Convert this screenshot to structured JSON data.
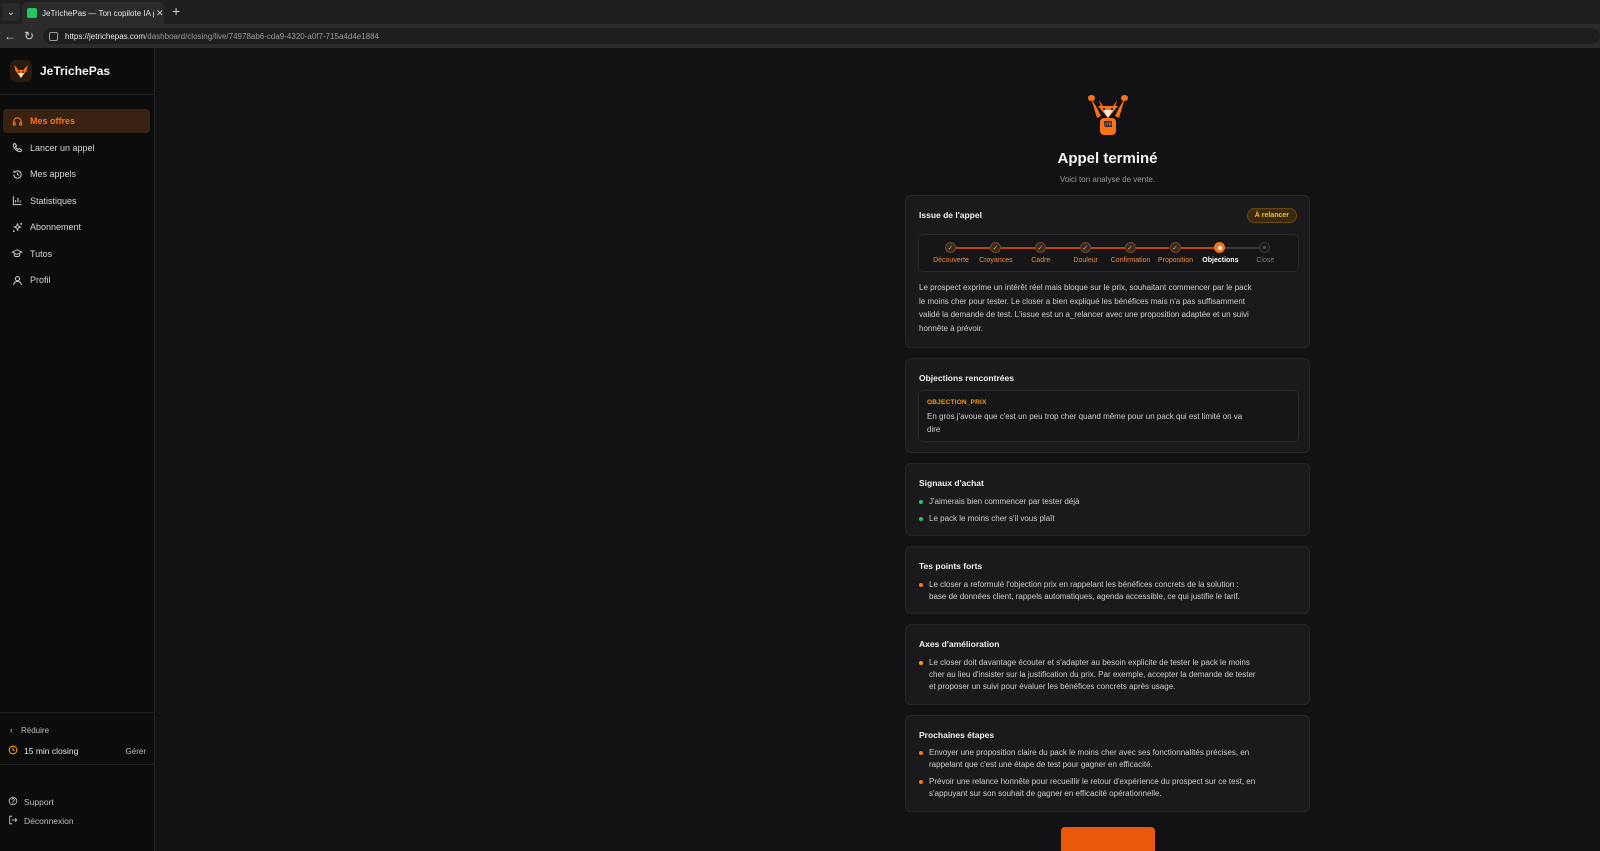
{
  "browser": {
    "tab_title": "JeTrichePas — Ton copilote IA pour",
    "url_host": "https://jetrichepas.com",
    "url_path": "/dashboard/closing/live/74978ab6-cda9-4320-a0f7-715a4d4e1884"
  },
  "sidebar": {
    "brand": "JeTrichePas",
    "items": [
      {
        "label": "Mes offres",
        "icon": "headphones-icon"
      },
      {
        "label": "Lancer un appel",
        "icon": "phone-icon"
      },
      {
        "label": "Mes appels",
        "icon": "history-icon"
      },
      {
        "label": "Statistiques",
        "icon": "bar-chart-icon"
      },
      {
        "label": "Abonnement",
        "icon": "sparkles-icon"
      },
      {
        "label": "Tutos",
        "icon": "graduation-cap-icon"
      },
      {
        "label": "Profil",
        "icon": "user-icon"
      }
    ],
    "reduce_label": "Réduire",
    "plan_label": "15 min closing",
    "manage_label": "Gérer",
    "support_label": "Support",
    "logout_label": "Déconnexion"
  },
  "main": {
    "title": "Appel terminé",
    "subtitle": "Voici ton analyse de vente.",
    "outcome": {
      "title": "Issue de l'appel",
      "badge": "À relancer",
      "steps": [
        {
          "label": "Découverte",
          "state": "done"
        },
        {
          "label": "Croyances",
          "state": "done"
        },
        {
          "label": "Cadre",
          "state": "done"
        },
        {
          "label": "Douleur",
          "state": "done"
        },
        {
          "label": "Confirmation",
          "state": "done"
        },
        {
          "label": "Proposition",
          "state": "done"
        },
        {
          "label": "Objections",
          "state": "current"
        },
        {
          "label": "Close",
          "state": "todo"
        }
      ],
      "summary_lines": [
        "Le prospect exprime un intérêt réel mais bloque sur le prix, souhaitant commencer par le pack",
        "le moins cher pour tester. Le closer a bien expliqué les bénéfices mais n'a pas suffisamment",
        "validé la demande de test. L'issue est un a_relancer avec une proposition adaptée et un suivi",
        "honnête à prévoir."
      ]
    },
    "objections": {
      "title": "Objections rencontrées",
      "tag": "OBJECTION_PRIX",
      "lines": [
        "En gros j'avoue que c'est un peu trop cher quand même pour un pack qui est limité on va",
        "dire"
      ]
    },
    "signals": {
      "title": "Signaux d'achat",
      "items": [
        "J'aimerais bien commencer par tester déjà",
        "Le pack le moins cher s'il vous plaît"
      ]
    },
    "strengths": {
      "title": "Tes points forts",
      "items": [
        [
          "Le closer a reformulé l'objection prix en rappelant les bénéfices concrets de la solution :",
          "base de données client, rappels automatiques, agenda accessible, ce qui justifie le tarif."
        ]
      ]
    },
    "improvements": {
      "title": "Axes d'amélioration",
      "items": [
        [
          "Le closer doit davantage écouter et s'adapter au besoin explicite de tester le pack le moins",
          "cher au lieu d'insister sur la justification du prix. Par exemple, accepter la demande de tester",
          "et proposer un suivi pour évaluer les bénéfices concrets après usage."
        ]
      ]
    },
    "next_steps": {
      "title": "Prochaines étapes",
      "items": [
        [
          "Envoyer une proposition claire du pack le moins cher avec ses fonctionnalités précises, en",
          "rappelant que c'est une étape de test pour gagner en efficacité."
        ],
        [
          "Prévoir une relance honnête pour recueillir le retour d'expérience du prospect sur ce test, en",
          "s'appuyant sur son souhait de gagner en efficacité opérationnelle."
        ]
      ]
    }
  },
  "colors": {
    "accent": "#f97316",
    "background": "#121214",
    "card": "#1a1a1c",
    "sidebar": "#0c0c0d"
  }
}
